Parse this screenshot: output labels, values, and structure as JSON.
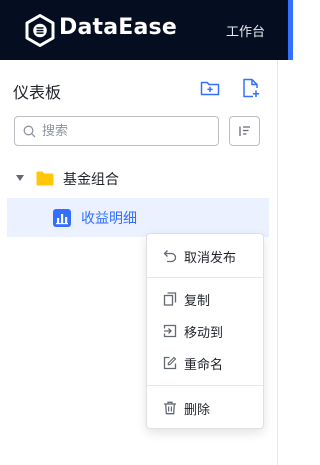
{
  "header": {
    "logo_text": "DataEase",
    "nav_workbench": "工作台",
    "background": "#050e21",
    "accent": "#3370ff"
  },
  "panel": {
    "title": "仪表板",
    "new_folder_icon": "folder-add-icon",
    "new_dashboard_icon": "file-add-icon"
  },
  "search": {
    "placeholder": "搜索",
    "value": "",
    "sort_icon": "sort-icon"
  },
  "tree": {
    "folder": {
      "label": "基金组合",
      "expanded": true,
      "icon": "folder-icon",
      "color": "#ffc60a"
    },
    "items": [
      {
        "label": "收益明细",
        "selected": true,
        "icon": "chart-icon"
      }
    ]
  },
  "context_menu": {
    "items": [
      {
        "label": "取消发布",
        "icon": "undo-icon"
      },
      {
        "label": "复制",
        "icon": "copy-icon"
      },
      {
        "label": "移动到",
        "icon": "move-icon"
      },
      {
        "label": "重命名",
        "icon": "rename-icon"
      },
      {
        "label": "删除",
        "icon": "trash-icon"
      }
    ]
  }
}
